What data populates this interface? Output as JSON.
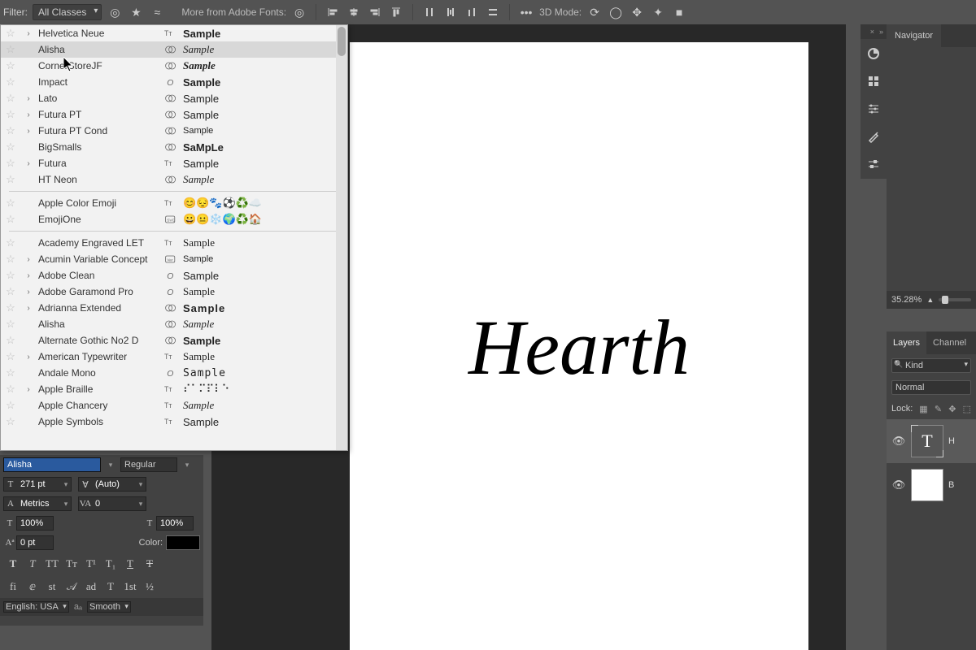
{
  "topbar": {
    "filter_label": "Filter:",
    "filter_value": "All Classes",
    "more_fonts": "More from Adobe Fonts:",
    "mode3d_label": "3D Mode:"
  },
  "font_dropdown": {
    "groups": [
      {
        "fonts": [
          {
            "name": "Helvetica Neue",
            "expandable": true,
            "origin": "tt",
            "sample": "Sample",
            "style": "font-weight:600"
          },
          {
            "name": "Alisha",
            "expandable": false,
            "origin": "cc",
            "sample": "Sample",
            "style": "font-style:italic;font-family:cursive",
            "hovered": true
          },
          {
            "name": "CornerStoreJF",
            "expandable": false,
            "origin": "cc",
            "sample": "Sample",
            "style": "font-family:cursive;font-weight:700;font-style:italic"
          },
          {
            "name": "Impact",
            "expandable": false,
            "origin": "O",
            "sample": "Sample",
            "style": "font-weight:800"
          },
          {
            "name": "Lato",
            "expandable": true,
            "origin": "cc",
            "sample": "Sample",
            "style": ""
          },
          {
            "name": "Futura PT",
            "expandable": true,
            "origin": "cc",
            "sample": "Sample",
            "style": ""
          },
          {
            "name": "Futura PT Cond",
            "expandable": true,
            "origin": "cc",
            "sample": "Sample",
            "style": "font-stretch:condensed;font-size:11px"
          },
          {
            "name": "BigSmalls",
            "expandable": false,
            "origin": "cc",
            "sample": "SaMpLe",
            "style": "font-weight:700"
          },
          {
            "name": "Futura",
            "expandable": true,
            "origin": "tt",
            "sample": "Sample",
            "style": ""
          },
          {
            "name": "HT Neon",
            "expandable": false,
            "origin": "cc",
            "sample": "Sample",
            "style": "font-style:italic;font-family:cursive"
          }
        ]
      },
      {
        "fonts": [
          {
            "name": "Apple Color Emoji",
            "expandable": false,
            "origin": "tt",
            "sample": "😊😔🐾⚽♻️☁️",
            "style": ""
          },
          {
            "name": "EmojiOne",
            "expandable": false,
            "origin": "svg",
            "sample": "😀😐❄️🌍♻️🏠",
            "style": ""
          }
        ]
      },
      {
        "fonts": [
          {
            "name": "Academy Engraved LET",
            "expandable": false,
            "origin": "tt",
            "sample": "Sample",
            "style": "font-family:serif"
          },
          {
            "name": "Acumin Variable Concept",
            "expandable": true,
            "origin": "var",
            "sample": "Sample",
            "style": "font-size:11px"
          },
          {
            "name": "Adobe Clean",
            "expandable": true,
            "origin": "O",
            "sample": "Sample",
            "style": ""
          },
          {
            "name": "Adobe Garamond Pro",
            "expandable": true,
            "origin": "O",
            "sample": "Sample",
            "style": "font-family:serif"
          },
          {
            "name": "Adrianna Extended",
            "expandable": true,
            "origin": "cc",
            "sample": "Sample",
            "style": "font-weight:700;letter-spacing:1px"
          },
          {
            "name": "Alisha",
            "expandable": false,
            "origin": "cc",
            "sample": "Sample",
            "style": "font-style:italic;font-family:cursive"
          },
          {
            "name": "Alternate Gothic No2 D",
            "expandable": false,
            "origin": "cc",
            "sample": "Sample",
            "style": "font-weight:700;font-stretch:condensed"
          },
          {
            "name": "American Typewriter",
            "expandable": true,
            "origin": "tt",
            "sample": "Sample",
            "style": "font-family:serif"
          },
          {
            "name": "Andale Mono",
            "expandable": false,
            "origin": "O",
            "sample": "Sample",
            "style": "font-family:monospace;letter-spacing:1px"
          },
          {
            "name": "Apple Braille",
            "expandable": true,
            "origin": "tt",
            "sample": "⠎⠁⠍⠏⠇⠑",
            "style": ""
          },
          {
            "name": "Apple Chancery",
            "expandable": false,
            "origin": "tt",
            "sample": "Sample",
            "style": "font-style:italic;font-family:serif"
          },
          {
            "name": "Apple Symbols",
            "expandable": false,
            "origin": "tt",
            "sample": "Sample",
            "style": ""
          }
        ]
      }
    ]
  },
  "canvas": {
    "text": "Hearth"
  },
  "char_panel": {
    "font_name": "Alisha",
    "font_style": "Regular",
    "size": "271 pt",
    "leading": "(Auto)",
    "kerning": "Metrics",
    "tracking": "0",
    "vscale": "100%",
    "hscale": "100%",
    "baseline": "0 pt",
    "color_label": "Color:",
    "language": "English: USA",
    "aa": "Smooth"
  },
  "navigator": {
    "tab": "Navigator",
    "zoom": "35.28%"
  },
  "layers": {
    "tab_layers": "Layers",
    "tab_channels": "Channel",
    "kind": "Kind",
    "blend": "Normal",
    "lock_label": "Lock:",
    "items": [
      {
        "type": "text",
        "name": "H",
        "glyph": "T"
      },
      {
        "type": "fill",
        "name": "B",
        "glyph": ""
      }
    ]
  }
}
